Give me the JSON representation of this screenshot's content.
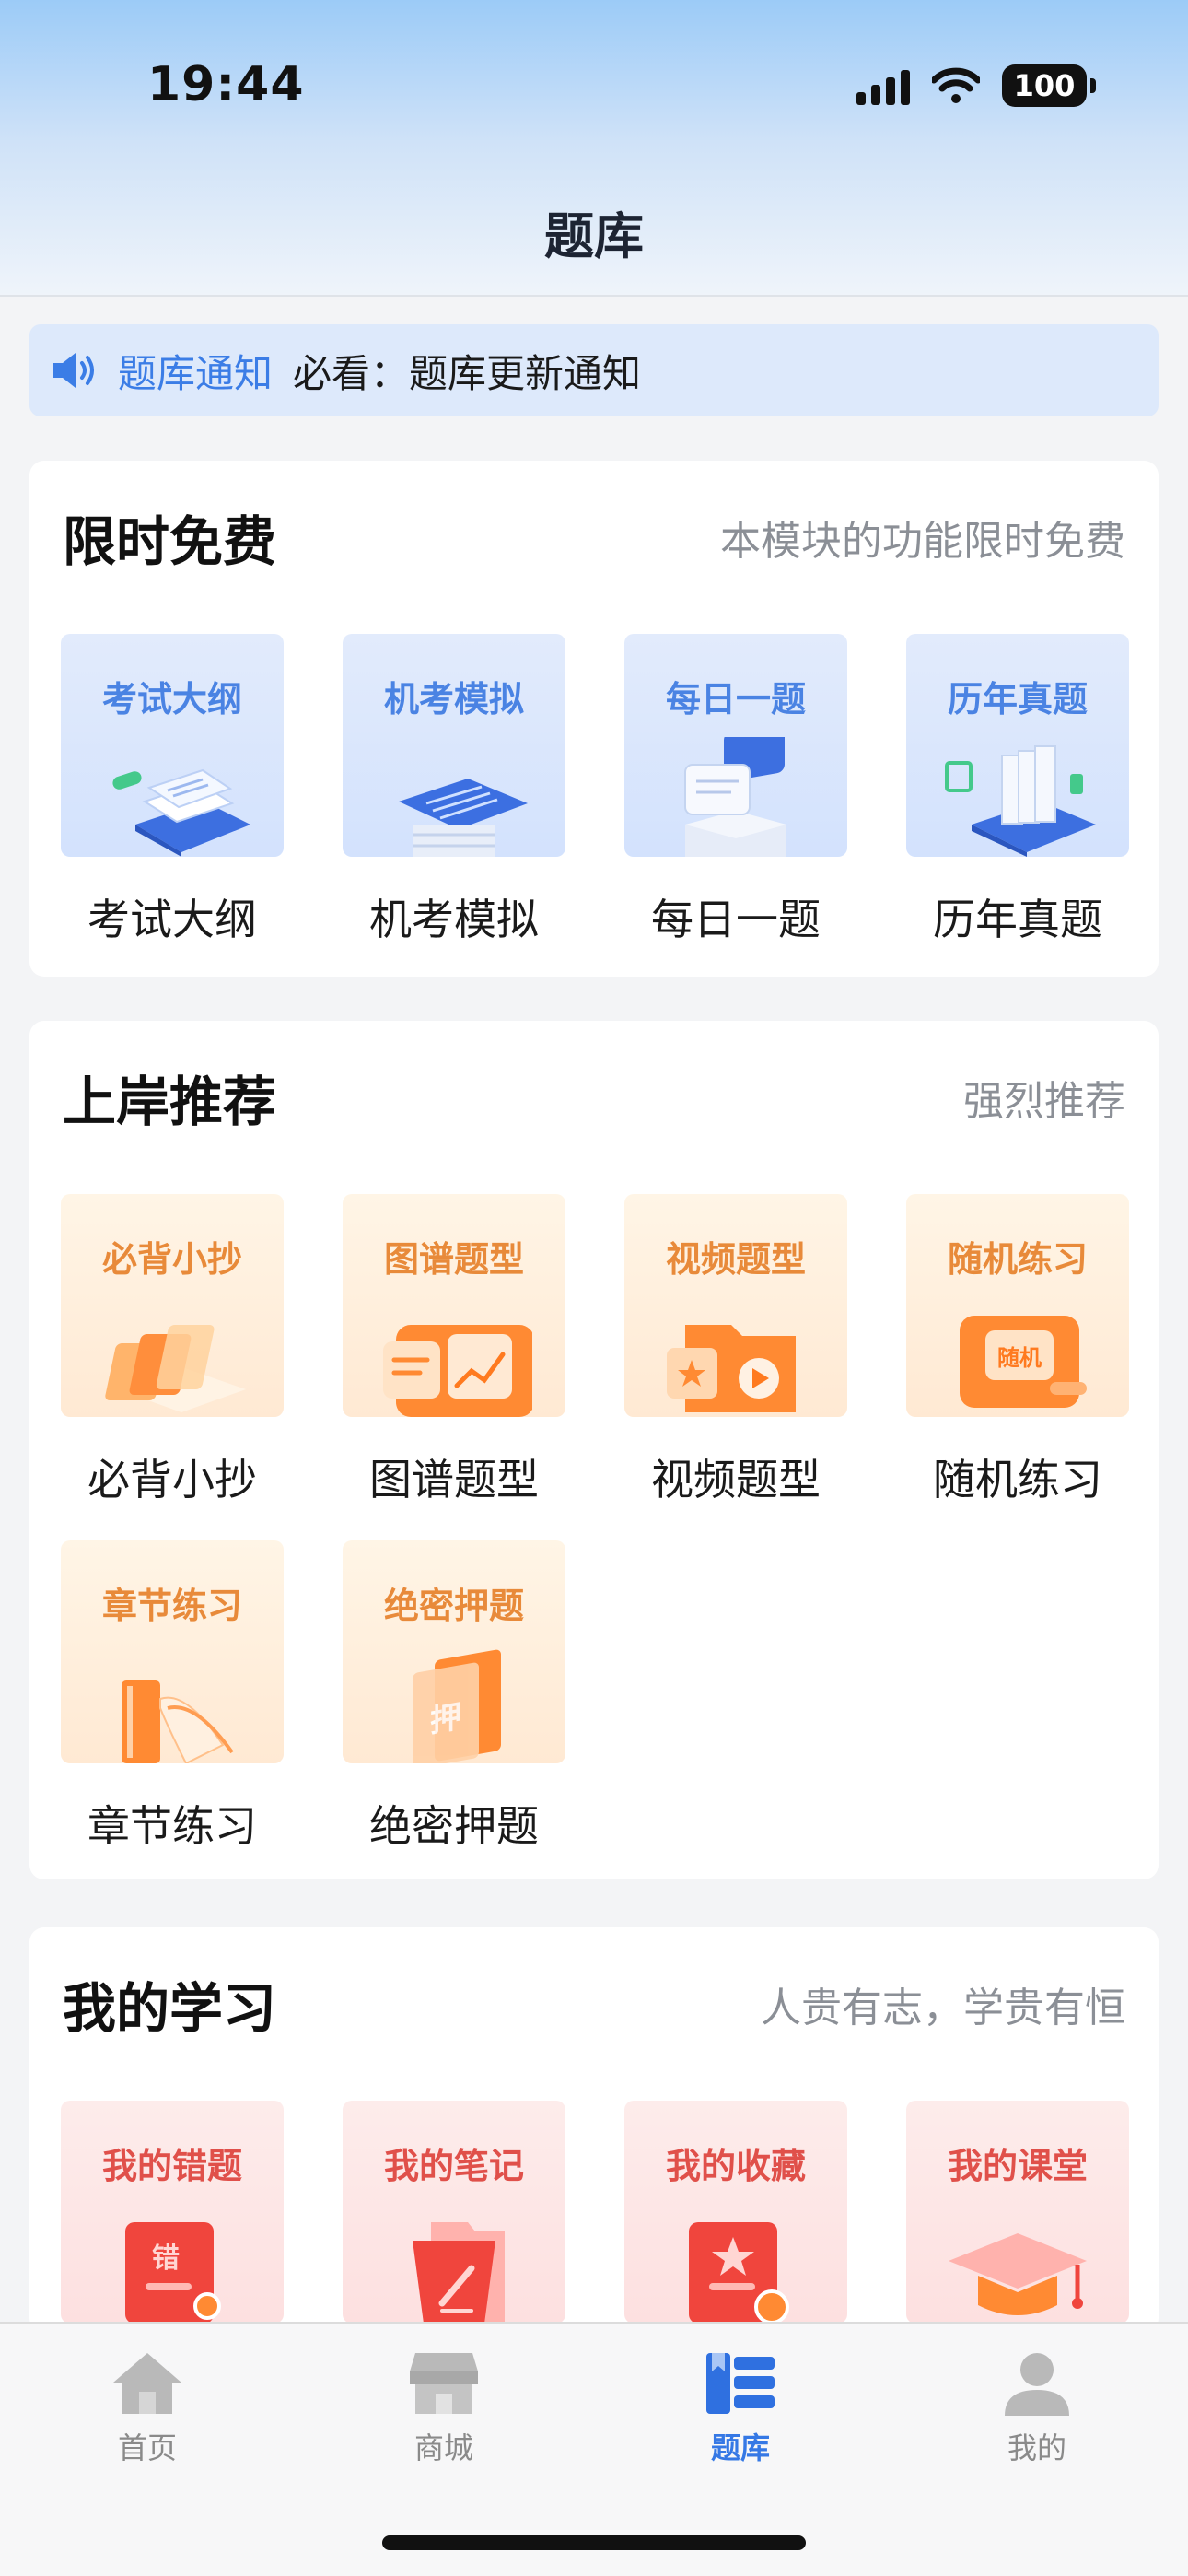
{
  "status_bar": {
    "time": "19:44",
    "battery": "100"
  },
  "header": {
    "title": "题库"
  },
  "notice": {
    "tag": "题库通知",
    "text": "必看：题库更新通知",
    "icon": "speaker-icon"
  },
  "sections": [
    {
      "title": "限时免费",
      "subtitle": "本模块的功能限时免费",
      "items": [
        {
          "badge": "考试大纲",
          "label": "考试大纲"
        },
        {
          "badge": "机考模拟",
          "label": "机考模拟"
        },
        {
          "badge": "每日一题",
          "label": "每日一题"
        },
        {
          "badge": "历年真题",
          "label": "历年真题"
        }
      ]
    },
    {
      "title": "上岸推荐",
      "subtitle": "强烈推荐",
      "items": [
        {
          "badge": "必背小抄",
          "label": "必背小抄"
        },
        {
          "badge": "图谱题型",
          "label": "图谱题型"
        },
        {
          "badge": "视频题型",
          "label": "视频题型"
        },
        {
          "badge": "随机练习",
          "label": "随机练习",
          "art_text": "随机"
        },
        {
          "badge": "章节练习",
          "label": "章节练习"
        },
        {
          "badge": "绝密押题",
          "label": "绝密押题",
          "art_text": "押"
        }
      ]
    },
    {
      "title": "我的学习",
      "subtitle": "人贵有志，学贵有恒",
      "items": [
        {
          "badge": "我的错题",
          "art_text": "错"
        },
        {
          "badge": "我的笔记"
        },
        {
          "badge": "我的收藏"
        },
        {
          "badge": "我的课堂"
        }
      ]
    }
  ],
  "tabbar": {
    "active": "题库",
    "tabs": [
      {
        "label": "首页",
        "icon": "home-icon"
      },
      {
        "label": "商城",
        "icon": "store-icon"
      },
      {
        "label": "题库",
        "icon": "question-bank-icon"
      },
      {
        "label": "我的",
        "icon": "profile-icon"
      }
    ]
  },
  "colors": {
    "accent": "#3578e5",
    "blue_tile_text": "#4a83e3",
    "orange_tile_text": "#e88a3a",
    "red_tile_text": "#e0504a"
  }
}
